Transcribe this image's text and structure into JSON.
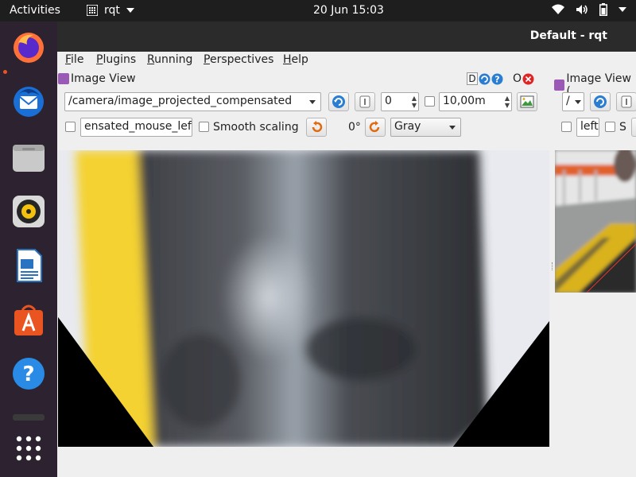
{
  "topbar": {
    "activities": "Activities",
    "app_name": "rqt",
    "clock": "20 Jun  15:03"
  },
  "dock": {
    "items": [
      "firefox-icon",
      "thunderbird-icon",
      "files-icon",
      "rhythmbox-icon",
      "libreoffice-writer-icon",
      "software-center-icon",
      "help-icon",
      "show-apps-icon"
    ]
  },
  "window": {
    "title": "Default - rqt",
    "menu": {
      "file": "File",
      "plugins": "Plugins",
      "running": "Running",
      "perspectives": "Perspectives",
      "help": "Help"
    }
  },
  "left_plugin": {
    "title": "Image View",
    "header_letters": {
      "d": "D",
      "o": "O"
    },
    "topic": "/camera/image_projected_compensated",
    "spin_value": "0",
    "max_value": "10,00m",
    "mouse_topic": "ensated_mouse_left",
    "smooth_scaling": "Smooth scaling",
    "rotation": "0°",
    "color_scheme": "Gray"
  },
  "right_plugin": {
    "title": "Image View (",
    "topic_partial": "/",
    "mouse_topic_partial": "left",
    "smooth_partial": "S"
  },
  "colors": {
    "topbar": "#1e1e1e",
    "dock": "#2c2230",
    "accent": "#e95420",
    "titlebar": "#2b2b2b"
  }
}
